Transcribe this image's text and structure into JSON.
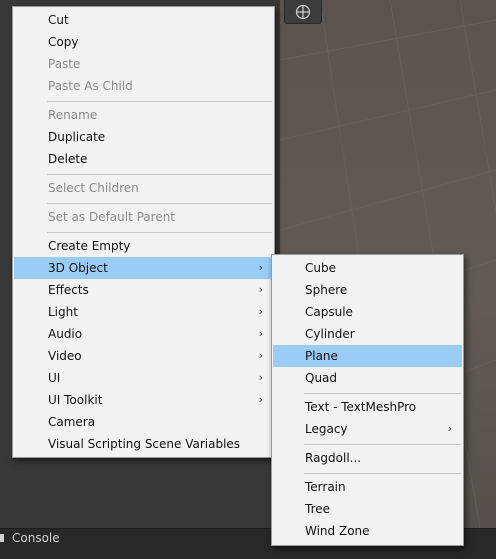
{
  "context_menu": {
    "items": [
      {
        "label": "Cut"
      },
      {
        "label": "Copy"
      },
      {
        "label": "Paste"
      },
      {
        "label": "Paste As Child"
      },
      {
        "label": "Rename"
      },
      {
        "label": "Duplicate"
      },
      {
        "label": "Delete"
      },
      {
        "label": "Select Children"
      },
      {
        "label": "Set as Default Parent"
      },
      {
        "label": "Create Empty"
      },
      {
        "label": "3D Object"
      },
      {
        "label": "Effects"
      },
      {
        "label": "Light"
      },
      {
        "label": "Audio"
      },
      {
        "label": "Video"
      },
      {
        "label": "UI"
      },
      {
        "label": "UI Toolkit"
      },
      {
        "label": "Camera"
      },
      {
        "label": "Visual Scripting Scene Variables"
      }
    ]
  },
  "submenu_3d": {
    "items": [
      {
        "label": "Cube"
      },
      {
        "label": "Sphere"
      },
      {
        "label": "Capsule"
      },
      {
        "label": "Cylinder"
      },
      {
        "label": "Plane"
      },
      {
        "label": "Quad"
      },
      {
        "label": "Text - TextMeshPro"
      },
      {
        "label": "Legacy"
      },
      {
        "label": "Ragdoll..."
      },
      {
        "label": "Terrain"
      },
      {
        "label": "Tree"
      },
      {
        "label": "Wind Zone"
      }
    ]
  },
  "submenu_arrow": "›",
  "bottom_bar": {
    "console_label": "Console"
  },
  "icons": {
    "scene_tool": "move-tool-icon",
    "console": "console-icon"
  }
}
